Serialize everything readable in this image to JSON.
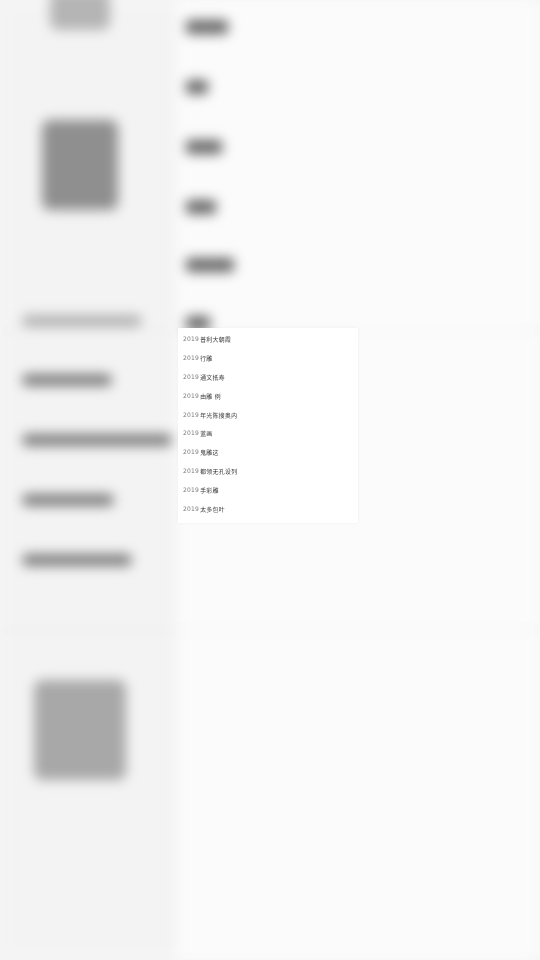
{
  "list": {
    "items": [
      {
        "num": "2019",
        "text": "普利大朝霞"
      },
      {
        "num": "2019",
        "text": "行雕"
      },
      {
        "num": "2019",
        "text": "通文抵寿"
      },
      {
        "num": "2019",
        "text": "由雕 例"
      },
      {
        "num": "2019",
        "text": "年光陈搜奥内"
      },
      {
        "num": "2019",
        "text": "蓝画"
      },
      {
        "num": "2019",
        "text": "鬼雕这"
      },
      {
        "num": "2019",
        "text": "都领无孔设列"
      },
      {
        "num": "2019",
        "text": "手彩雕"
      },
      {
        "num": "2019",
        "text": "太多包叶"
      }
    ]
  }
}
